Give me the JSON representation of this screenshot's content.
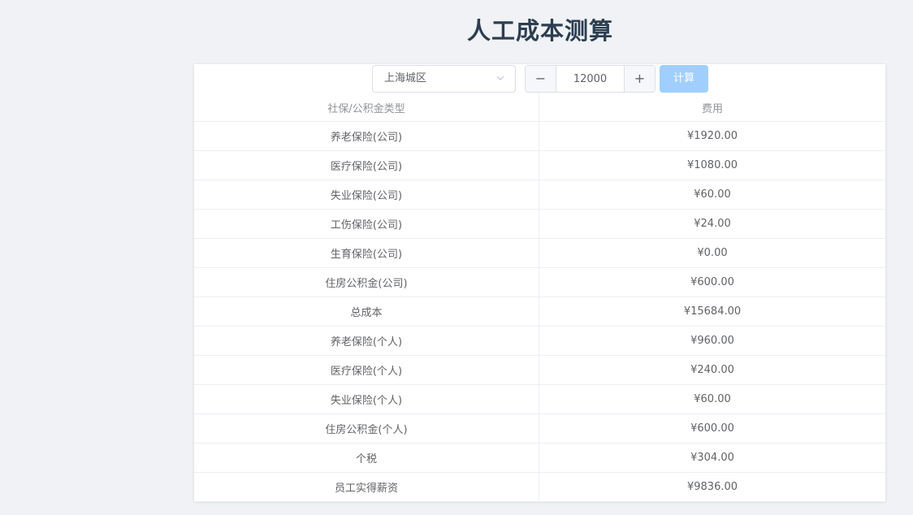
{
  "page_title": "人工成本测算",
  "toolbar": {
    "city_select": {
      "value": "上海城区",
      "icon": "chevron-down-icon"
    },
    "salary_stepper": {
      "value": "12000",
      "decrement_label": "−",
      "increment_label": "+"
    },
    "calculate_label": "计算",
    "calculate_color": "#a0cfff"
  },
  "table": {
    "headers": [
      "社保/公积金类型",
      "费用"
    ],
    "rows": [
      [
        "养老保险(公司)",
        "¥1920.00"
      ],
      [
        "医疗保险(公司)",
        "¥1080.00"
      ],
      [
        "失业保险(公司)",
        "¥60.00"
      ],
      [
        "工伤保险(公司)",
        "¥24.00"
      ],
      [
        "生育保险(公司)",
        "¥0.00"
      ],
      [
        "住房公积金(公司)",
        "¥600.00"
      ],
      [
        "总成本",
        "¥15684.00"
      ],
      [
        "养老保险(个人)",
        "¥960.00"
      ],
      [
        "医疗保险(个人)",
        "¥240.00"
      ],
      [
        "失业保险(个人)",
        "¥60.00"
      ],
      [
        "住房公积金(个人)",
        "¥600.00"
      ],
      [
        "个税",
        "¥304.00"
      ],
      [
        "员工实得薪资",
        "¥9836.00"
      ]
    ]
  },
  "colors": {
    "background": "#f0f2f5",
    "title": "#2c3e50",
    "border": "#ebeef5",
    "text": "#606266"
  }
}
